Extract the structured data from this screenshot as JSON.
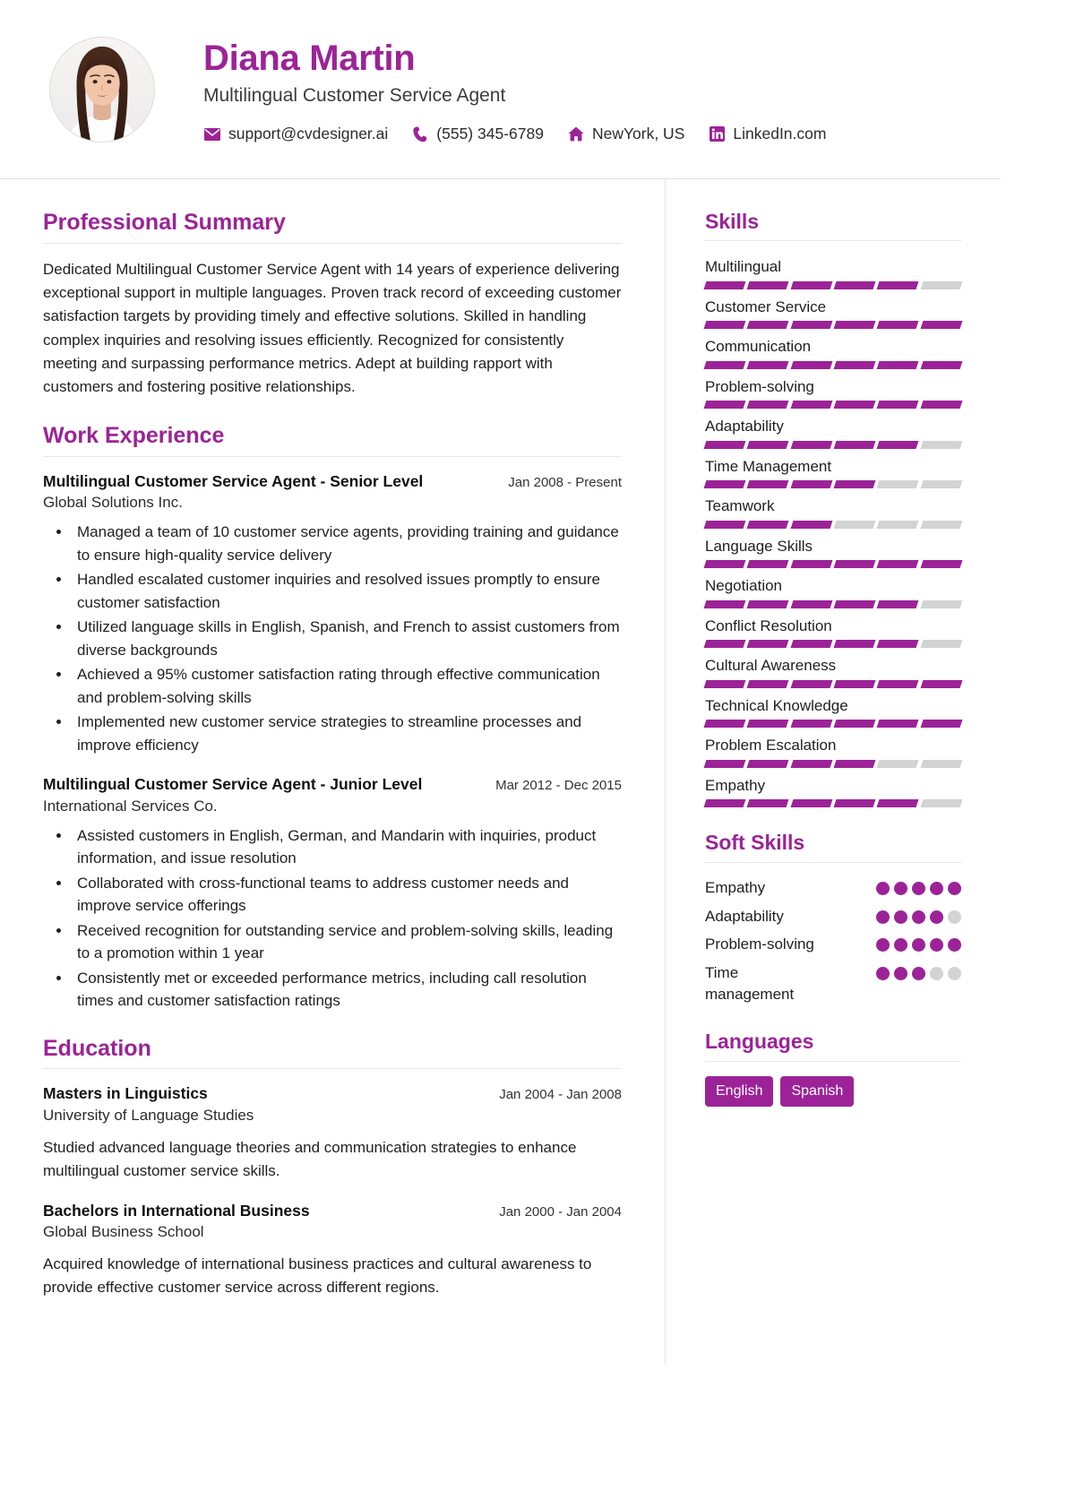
{
  "theme": {
    "accent": "#9C2397",
    "text": "#1F1F1F",
    "muted": "#D3D3D3",
    "rule": "#E6E6E6"
  },
  "header": {
    "name": "Diana Martin",
    "title": "Multilingual Customer Service Agent",
    "avatar_alt": "profile-photo",
    "contacts": [
      {
        "icon": "email-icon",
        "text": "support@cvdesigner.ai"
      },
      {
        "icon": "phone-icon",
        "text": "(555) 345-6789"
      },
      {
        "icon": "home-icon",
        "text": "NewYork, US"
      },
      {
        "icon": "linkedin-icon",
        "text": "LinkedIn.com"
      }
    ]
  },
  "main": {
    "summary": {
      "heading": "Professional Summary",
      "text": "Dedicated Multilingual Customer Service Agent with 14 years of experience delivering exceptional support in multiple languages. Proven track record of exceeding customer satisfaction targets by providing timely and effective solutions. Skilled in handling complex inquiries and resolving issues efficiently. Recognized for consistently meeting and surpassing performance metrics. Adept at building rapport with customers and fostering positive relationships."
    },
    "experience": {
      "heading": "Work Experience",
      "entries": [
        {
          "role": "Multilingual Customer Service Agent - Senior Level",
          "date": "Jan 2008 - Present",
          "org": "Global Solutions Inc.",
          "bullets": [
            "Managed a team of 10 customer service agents, providing training and guidance to ensure high-quality service delivery",
            "Handled escalated customer inquiries and resolved issues promptly to ensure customer satisfaction",
            "Utilized language skills in English, Spanish, and French to assist customers from diverse backgrounds",
            "Achieved a 95% customer satisfaction rating through effective communication and problem-solving skills",
            "Implemented new customer service strategies to streamline processes and improve efficiency"
          ]
        },
        {
          "role": "Multilingual Customer Service Agent - Junior Level",
          "date": "Mar 2012 - Dec 2015",
          "org": "International Services Co.",
          "bullets": [
            "Assisted customers in English, German, and Mandarin with inquiries, product information, and issue resolution",
            "Collaborated with cross-functional teams to address customer needs and improve service offerings",
            "Received recognition for outstanding service and problem-solving skills, leading to a promotion within 1 year",
            "Consistently met or exceeded performance metrics, including call resolution times and customer satisfaction ratings"
          ]
        }
      ]
    },
    "education": {
      "heading": "Education",
      "entries": [
        {
          "degree": "Masters in Linguistics",
          "date": "Jan 2004 - Jan 2008",
          "school": "University of Language Studies",
          "description": "Studied advanced language theories and communication strategies to enhance multilingual customer service skills."
        },
        {
          "degree": "Bachelors in International Business",
          "date": "Jan 2000 - Jan 2004",
          "school": "Global Business School",
          "description": "Acquired knowledge of international business practices and cultural awareness to provide effective customer service across different regions."
        }
      ]
    }
  },
  "sidebar": {
    "skills": {
      "heading": "Skills",
      "segments_total": 6,
      "items": [
        {
          "label": "Multilingual",
          "filled": 5
        },
        {
          "label": "Customer Service",
          "filled": 6
        },
        {
          "label": "Communication",
          "filled": 6
        },
        {
          "label": "Problem-solving",
          "filled": 6
        },
        {
          "label": "Adaptability",
          "filled": 5
        },
        {
          "label": "Time Management",
          "filled": 4
        },
        {
          "label": "Teamwork",
          "filled": 3
        },
        {
          "label": "Language Skills",
          "filled": 6
        },
        {
          "label": "Negotiation",
          "filled": 5
        },
        {
          "label": "Conflict Resolution",
          "filled": 5
        },
        {
          "label": "Cultural Awareness",
          "filled": 6
        },
        {
          "label": "Technical Knowledge",
          "filled": 6
        },
        {
          "label": "Problem Escalation",
          "filled": 4
        },
        {
          "label": "Empathy",
          "filled": 5
        }
      ]
    },
    "soft_skills": {
      "heading": "Soft Skills",
      "dots_total": 5,
      "items": [
        {
          "label": "Empathy",
          "filled": 5
        },
        {
          "label": "Adaptability",
          "filled": 4
        },
        {
          "label": "Problem-solving",
          "filled": 5
        },
        {
          "label": "Time management",
          "filled": 3
        }
      ]
    },
    "languages": {
      "heading": "Languages",
      "items": [
        "English",
        "Spanish"
      ]
    }
  }
}
